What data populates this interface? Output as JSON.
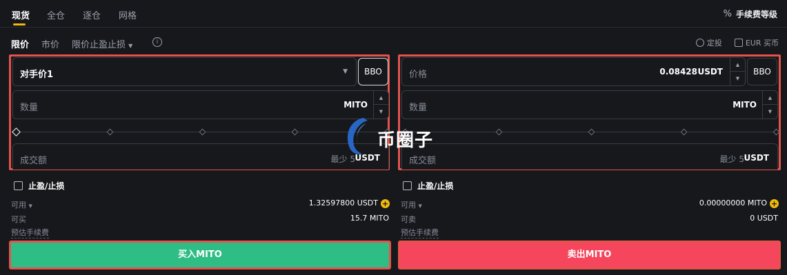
{
  "tabs": [
    {
      "label": "现货",
      "active": true
    },
    {
      "label": "全仓",
      "active": false
    },
    {
      "label": "逐仓",
      "active": false
    },
    {
      "label": "网格",
      "active": false
    }
  ],
  "fee_level": {
    "icon": "%",
    "label": "手续费等级"
  },
  "order_types": {
    "limit": "限价",
    "market": "市价",
    "tpsl": "限价止盈止损",
    "info_icon": "i"
  },
  "tools": {
    "dca": "定投",
    "buy_eur": "EUR 买币"
  },
  "buy": {
    "price_mode": "对手价1",
    "bbo": "BBO",
    "qty_label": "数量",
    "qty_unit": "MITO",
    "total_label": "成交额",
    "total_min": "最少 5",
    "total_unit": "USDT",
    "tpsl_label": "止盈/止损",
    "available_label": "可用",
    "available_value": "1.32597800 USDT",
    "max_label": "可买",
    "max_value": "15.7 MITO",
    "fee_label": "预估手续费",
    "button": "买入MITO"
  },
  "sell": {
    "price_label": "价格",
    "price_value": "0.08428",
    "price_unit": "USDT",
    "bbo": "BBO",
    "qty_label": "数量",
    "qty_unit": "MITO",
    "total_label": "成交额",
    "total_min": "最少 5",
    "total_unit": "USDT",
    "tpsl_label": "止盈/止损",
    "available_label": "可用",
    "available_value": "0.00000000 MITO",
    "max_label": "可卖",
    "max_value": "0 USDT",
    "fee_label": "预估手续费",
    "button": "卖出MITO"
  },
  "watermark": "币圈子",
  "colors": {
    "accent": "#f0b90b",
    "buy": "#2ebd85",
    "sell": "#f6465d",
    "highlight": "#e5534b"
  }
}
